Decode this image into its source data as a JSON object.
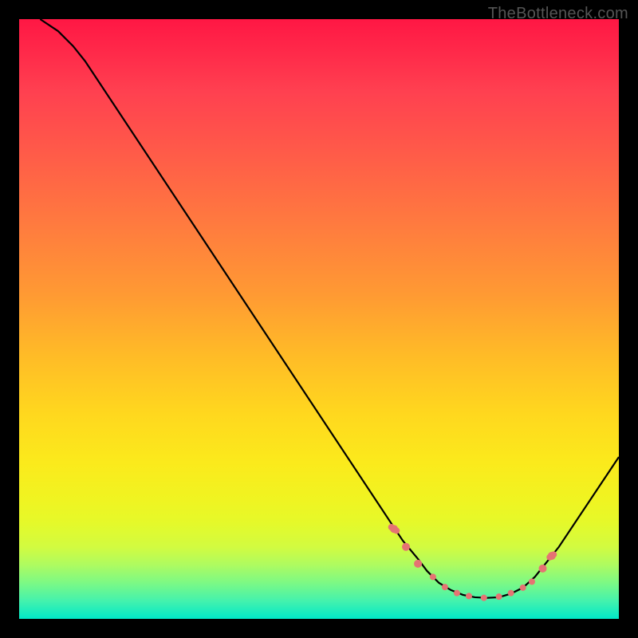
{
  "watermark": "TheBottleneck.com",
  "chart_data": {
    "type": "line",
    "title": "",
    "xlabel": "",
    "ylabel": "",
    "xlim": [
      0,
      100
    ],
    "ylim": [
      0,
      100
    ],
    "grid": false,
    "curve_points": [
      {
        "x": 3.5,
        "y": 100
      },
      {
        "x": 6.5,
        "y": 98
      },
      {
        "x": 9,
        "y": 95.5
      },
      {
        "x": 11,
        "y": 93
      },
      {
        "x": 62,
        "y": 16
      },
      {
        "x": 64,
        "y": 13
      },
      {
        "x": 66.5,
        "y": 10
      },
      {
        "x": 68,
        "y": 8
      },
      {
        "x": 70,
        "y": 6
      },
      {
        "x": 72,
        "y": 4.8
      },
      {
        "x": 74,
        "y": 4.0
      },
      {
        "x": 76,
        "y": 3.6
      },
      {
        "x": 78,
        "y": 3.5
      },
      {
        "x": 80,
        "y": 3.6
      },
      {
        "x": 82,
        "y": 4.2
      },
      {
        "x": 84,
        "y": 5.2
      },
      {
        "x": 86,
        "y": 7.0
      },
      {
        "x": 88,
        "y": 9.5
      },
      {
        "x": 90,
        "y": 12
      },
      {
        "x": 100,
        "y": 27
      }
    ],
    "markers": [
      {
        "x": 62.5,
        "y": 15,
        "r": 5
      },
      {
        "x": 64.5,
        "y": 12,
        "r": 5
      },
      {
        "x": 66.5,
        "y": 9.2,
        "r": 5
      },
      {
        "x": 69,
        "y": 7,
        "r": 4
      },
      {
        "x": 71,
        "y": 5.3,
        "r": 4
      },
      {
        "x": 73,
        "y": 4.3,
        "r": 4
      },
      {
        "x": 75,
        "y": 3.8,
        "r": 4
      },
      {
        "x": 77.5,
        "y": 3.5,
        "r": 4
      },
      {
        "x": 80,
        "y": 3.7,
        "r": 4
      },
      {
        "x": 82,
        "y": 4.3,
        "r": 4
      },
      {
        "x": 84,
        "y": 5.2,
        "r": 4
      },
      {
        "x": 85.5,
        "y": 6.2,
        "r": 4
      },
      {
        "x": 87.3,
        "y": 8.4,
        "r": 5
      },
      {
        "x": 88.8,
        "y": 10.5,
        "r": 5
      }
    ],
    "marker_caps": [
      {
        "x": 62.5,
        "y": 15,
        "w": 8,
        "h": 16,
        "rot": -56
      },
      {
        "x": 88.8,
        "y": 10.5,
        "w": 8,
        "h": 14,
        "rot": 56
      }
    ],
    "colors": {
      "curve": "#000000",
      "markers": "#e57373",
      "background_top": "#ff1744",
      "background_bottom": "#00e8c8"
    }
  }
}
